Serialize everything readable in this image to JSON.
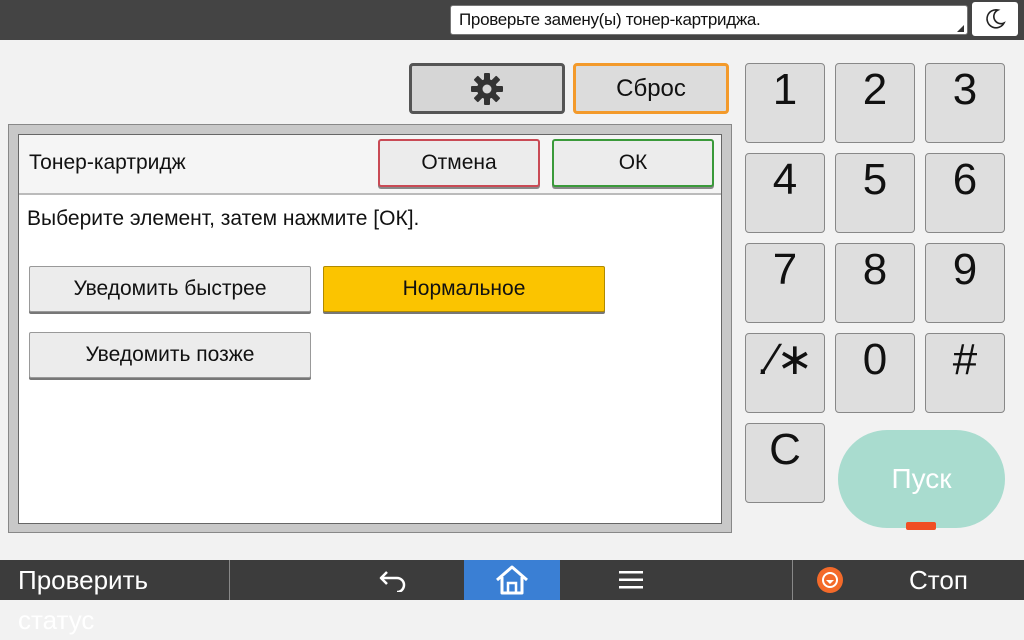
{
  "topbar": {
    "notice": "Проверьте замену(ы) тонер-картриджа.",
    "moon_icon": "moon-icon"
  },
  "controls": {
    "settings_icon": "gear-icon",
    "reset_label": "Сброс"
  },
  "dialog": {
    "title": "Тонер-картридж",
    "cancel_label": "Отмена",
    "ok_label": "ОК",
    "instruction": "Выберите элемент, затем нажмите [ОК].",
    "options": [
      {
        "label": "Уведомить быстрее",
        "selected": false
      },
      {
        "label": "Нормальное",
        "selected": true
      },
      {
        "label": "Уведомить позже",
        "selected": false
      }
    ]
  },
  "keypad": {
    "keys": [
      "1",
      "2",
      "3",
      "4",
      "5",
      "6",
      "7",
      "8",
      "9",
      ".∕∗",
      "0",
      "#",
      "C"
    ],
    "start_label": "Пуск"
  },
  "bottombar": {
    "status_label": "Проверить статус",
    "back_icon": "back-arrow-icon",
    "home_icon": "home-icon",
    "menu_icon": "menu-icon",
    "stop_icon": "stop-icon",
    "stop_label": "Стоп"
  },
  "colors": {
    "selected": "#fbc400",
    "reset_border": "#f39a2b",
    "ok_border": "#3a9a3a",
    "cancel_border": "#c94a55",
    "start": "#a9dccf",
    "home_active": "#3a7fd4"
  }
}
